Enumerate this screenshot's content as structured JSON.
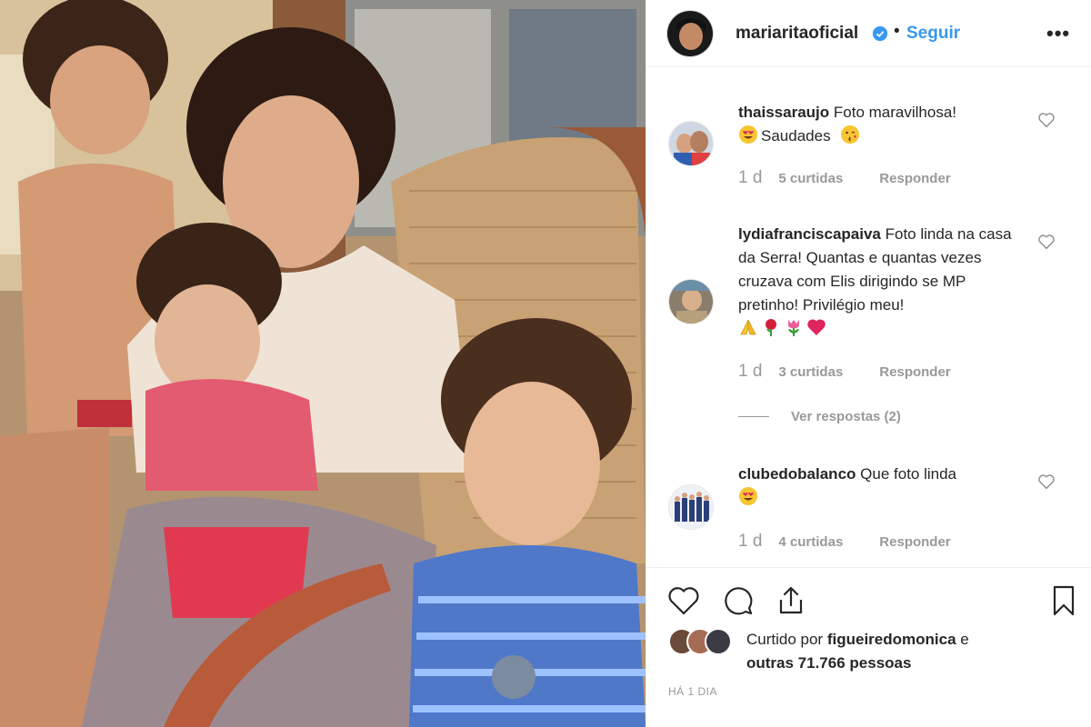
{
  "post": {
    "username": "mariaritaoficial",
    "follow_label": "Seguir",
    "dot": "•",
    "more_label": "•••"
  },
  "comments": [
    {
      "username": "thaissaraujo",
      "text": "Foto maravilhosa!",
      "text2": "Saudades",
      "emojis1": [
        "heart-eyes"
      ],
      "emojis2": [
        "kissing-face"
      ],
      "time": "1 d",
      "likes": "5 curtidas",
      "reply": "Responder"
    },
    {
      "username": "lydiafranciscapaiva",
      "text": "Foto linda na casa da Serra! Quantas e quantas vezes cruzava com Elis dirigindo se MP pretinho! Privilégio meu!",
      "emojis": [
        "folded-hands",
        "rose",
        "tulip",
        "heart"
      ],
      "time": "1 d",
      "likes": "3 curtidas",
      "reply": "Responder",
      "view_replies": "Ver respostas (2)"
    },
    {
      "username": "clubedobalanco",
      "text": "Que foto linda",
      "emojis": [
        "heart-eyes"
      ],
      "time": "1 d",
      "likes": "4 curtidas",
      "reply": "Responder"
    }
  ],
  "likes": {
    "prefix": "Curtido por",
    "user": "figueiredomonica",
    "middle": "e",
    "others": "outras 71.766 pessoas"
  },
  "timestamp": "HÁ 1 DIA",
  "colors": {
    "accent": "#3897f0",
    "muted": "#999999",
    "text": "#262626",
    "verified": "#3897f0",
    "heart_emoji": "#e0245e"
  }
}
